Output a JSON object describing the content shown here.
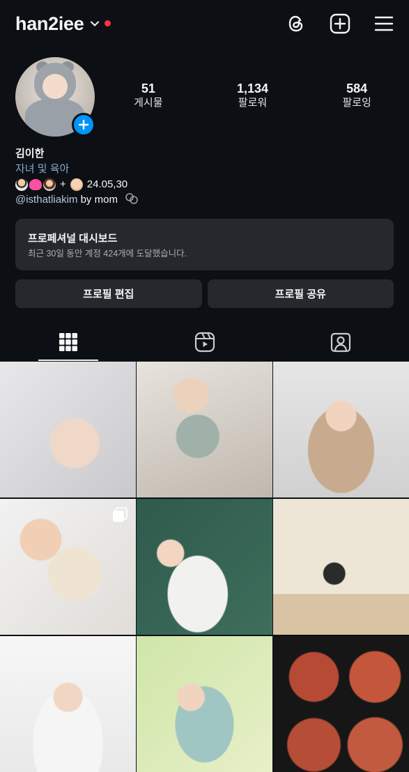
{
  "header": {
    "username": "han2iee"
  },
  "profile": {
    "stats": [
      {
        "value": "51",
        "label": "게시물"
      },
      {
        "value": "1,134",
        "label": "팔로워"
      },
      {
        "value": "584",
        "label": "팔로잉"
      }
    ],
    "name": "김이한",
    "category": "자녀 및 육아",
    "bio_text": "+",
    "bio_date": "24.05,30",
    "mention": "@isthatliakim",
    "mention_suffix": "by mom"
  },
  "dashboard": {
    "title": "프로페셔널 대시보드",
    "subtitle": "최근 30일 동안 계정 424개에 도달했습니다."
  },
  "buttons": {
    "edit_profile": "프로필 편집",
    "share_profile": "프로필 공유"
  },
  "tabs": [
    {
      "icon": "grid-icon",
      "active": true
    },
    {
      "icon": "reels-icon",
      "active": false
    },
    {
      "icon": "tagged-icon",
      "active": false
    }
  ],
  "colors": {
    "background": "#0c1014",
    "accent_blue": "#0095f6",
    "notification_red": "#ff3040",
    "card": "#25292e"
  }
}
